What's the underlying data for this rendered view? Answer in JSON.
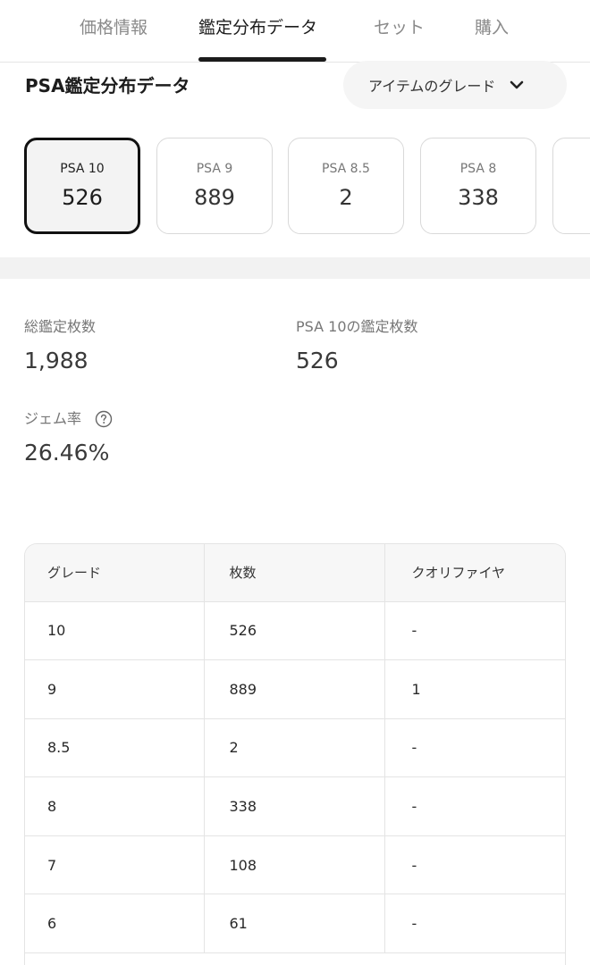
{
  "tabs": [
    {
      "label": "価格情報",
      "active": false
    },
    {
      "label": "鑑定分布データ",
      "active": true
    },
    {
      "label": "セット",
      "active": false
    },
    {
      "label": "購入",
      "active": false
    }
  ],
  "section": {
    "title": "PSA鑑定分布データ",
    "grade_select": "アイテムのグレード"
  },
  "grade_cards": [
    {
      "label": "PSA 10",
      "count": "526",
      "selected": true
    },
    {
      "label": "PSA 9",
      "count": "889",
      "selected": false
    },
    {
      "label": "PSA 8.5",
      "count": "2",
      "selected": false
    },
    {
      "label": "PSA 8",
      "count": "338",
      "selected": false
    }
  ],
  "stats": {
    "total_label": "総鑑定枚数",
    "total_value": "1,988",
    "psa10_label": "PSA 10の鑑定枚数",
    "psa10_value": "526",
    "gem_label": "ジェム率",
    "gem_value": "26.46%"
  },
  "table": {
    "headers": [
      "グレード",
      "枚数",
      "クオリファイヤ"
    ],
    "rows": [
      [
        "10",
        "526",
        "-"
      ],
      [
        "9",
        "889",
        "1"
      ],
      [
        "8.5",
        "2",
        "-"
      ],
      [
        "8",
        "338",
        "-"
      ],
      [
        "7",
        "108",
        "-"
      ],
      [
        "6",
        "61",
        "-"
      ]
    ]
  },
  "colors": {
    "accent": "#1b1b1b",
    "muted_text": "#777777",
    "band": "#f2f2f2"
  }
}
